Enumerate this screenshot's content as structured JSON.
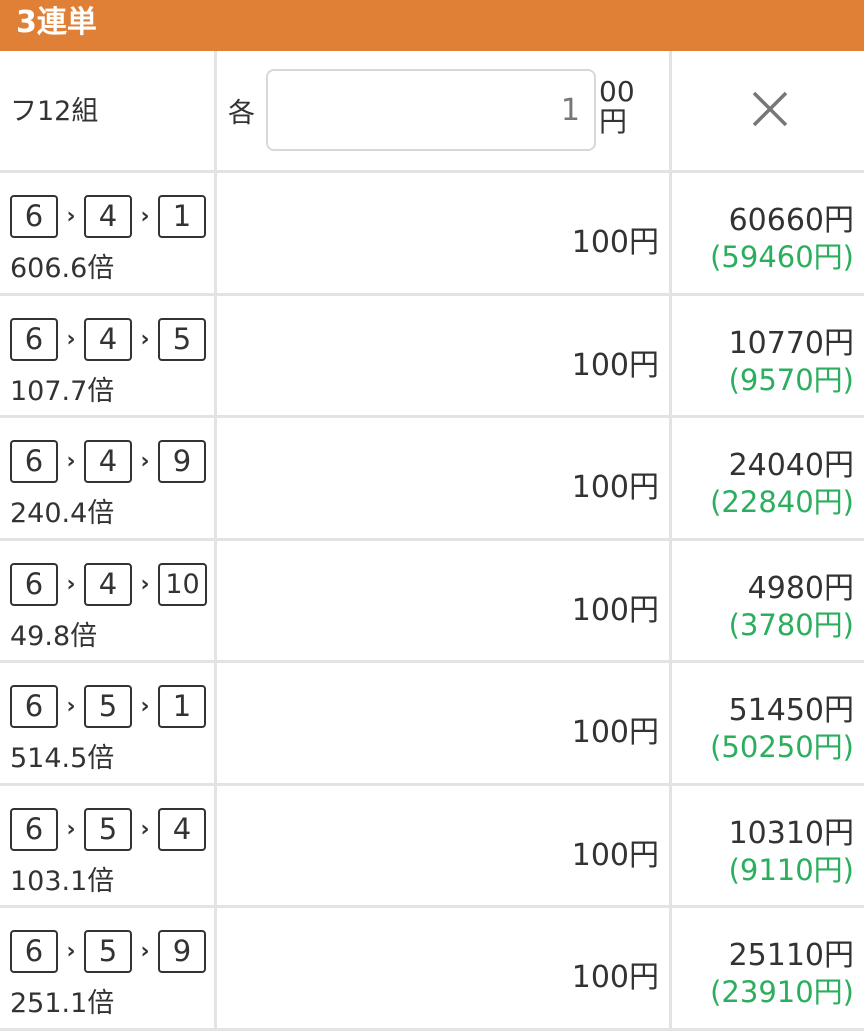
{
  "header": {
    "title": "3連単",
    "combo_count_label": "フ12組",
    "each_label": "各",
    "amount_value": "1",
    "amount_unit_line1": "00",
    "amount_unit_line2": "円",
    "close_icon": "close-icon"
  },
  "colors": {
    "title_bar": "#E07F36",
    "profit_green": "#2BAE5E",
    "grid_line": "#e3e3e3"
  },
  "bets": [
    {
      "first": "6",
      "second": "4",
      "third": "1",
      "odds": "606.6倍",
      "stake": "100円",
      "payout": "60660円",
      "profit": "(59460円)"
    },
    {
      "first": "6",
      "second": "4",
      "third": "5",
      "odds": "107.7倍",
      "stake": "100円",
      "payout": "10770円",
      "profit": "(9570円)"
    },
    {
      "first": "6",
      "second": "4",
      "third": "9",
      "odds": "240.4倍",
      "stake": "100円",
      "payout": "24040円",
      "profit": "(22840円)"
    },
    {
      "first": "6",
      "second": "4",
      "third": "10",
      "odds": "49.8倍",
      "stake": "100円",
      "payout": "4980円",
      "profit": "(3780円)"
    },
    {
      "first": "6",
      "second": "5",
      "third": "1",
      "odds": "514.5倍",
      "stake": "100円",
      "payout": "51450円",
      "profit": "(50250円)"
    },
    {
      "first": "6",
      "second": "5",
      "third": "4",
      "odds": "103.1倍",
      "stake": "100円",
      "payout": "10310円",
      "profit": "(9110円)"
    },
    {
      "first": "6",
      "second": "5",
      "third": "9",
      "odds": "251.1倍",
      "stake": "100円",
      "payout": "25110円",
      "profit": "(23910円)"
    }
  ]
}
